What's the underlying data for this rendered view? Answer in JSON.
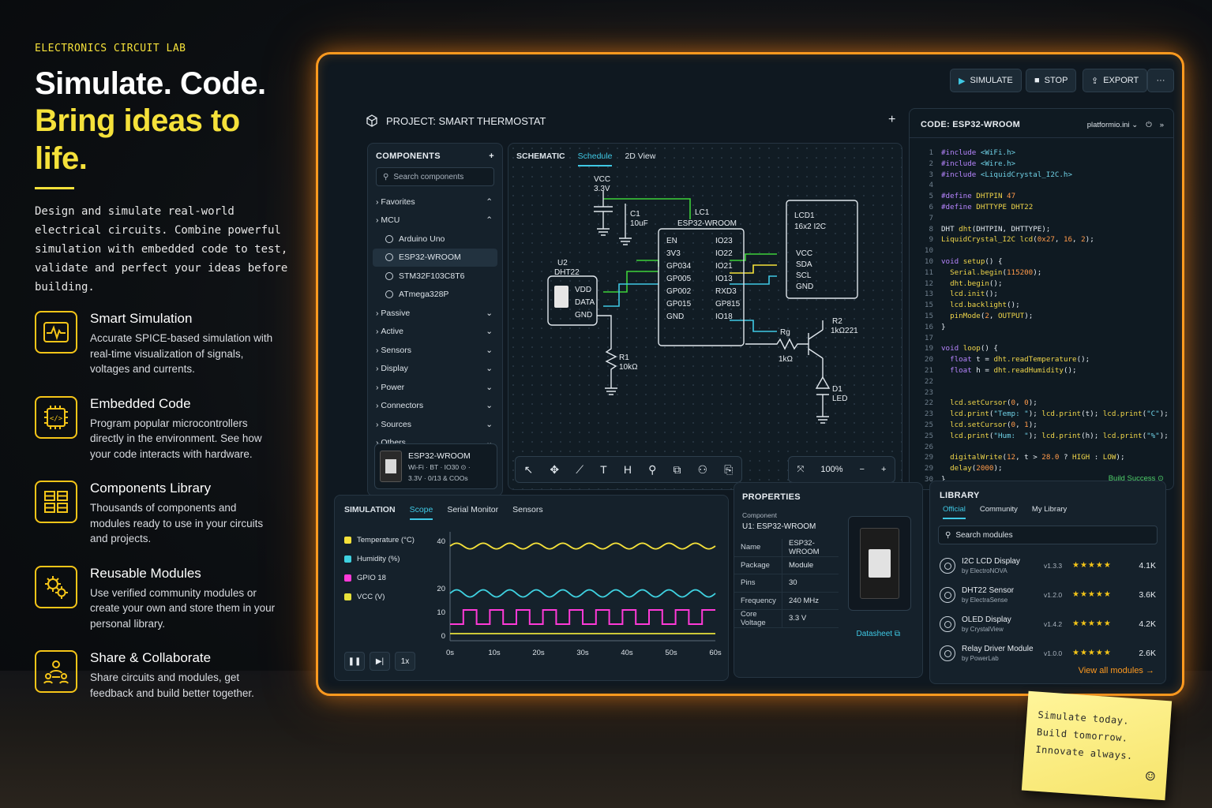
{
  "left": {
    "eyebrow": "ELECTRONICS CIRCUIT LAB",
    "headline_1": "Simulate. Code.",
    "headline_2": "Bring ideas to life.",
    "intro": "Design and simulate real-world electrical circuits. Combine powerful simulation with embedded code to test, validate and perfect your ideas before building.",
    "features": [
      {
        "icon": "waveform-icon",
        "title": "Smart Simulation",
        "desc": "Accurate SPICE-based simulation with real-time visualization of signals, voltages and currents."
      },
      {
        "icon": "chip-code-icon",
        "title": "Embedded Code",
        "desc": "Program popular microcontrollers directly in the environment. See how your code interacts with hardware."
      },
      {
        "icon": "library-icon",
        "title": "Components Library",
        "desc": "Thousands of components and modules ready to use in your circuits and projects."
      },
      {
        "icon": "gears-icon",
        "title": "Reusable Modules",
        "desc": "Use verified community modules or create your own and store them in your personal library."
      },
      {
        "icon": "users-icon",
        "title": "Share & Collaborate",
        "desc": "Share circuits and modules, get feedback and build better together."
      }
    ]
  },
  "toolbar": {
    "simulate": "SIMULATE",
    "stop": "STOP",
    "export": "EXPORT",
    "more": "···"
  },
  "project": {
    "title": "PROJECT: SMART THERMOSTAT",
    "add": "+"
  },
  "components": {
    "title": "COMPONENTS",
    "search_placeholder": "Search components",
    "favorites": "Favorites",
    "mcu": "MCU",
    "mcu_items": [
      "Arduino Uno",
      "ESP32-WROOM",
      "STM32F103C8T6",
      "ATmega328P"
    ],
    "categories": [
      "Passive",
      "Active",
      "Sensors",
      "Display",
      "Power",
      "Connectors",
      "Sources",
      "Others"
    ],
    "card_title": "ESP32-WROOM",
    "card_line1": "Wi-Fi · BT · IO30 ⊙ ·",
    "card_line2": "3.3V · 0/13 & COOs"
  },
  "schematic": {
    "tabs": [
      "SCHEMATIC",
      "Schedule",
      "2D View"
    ],
    "vcc": "VCC",
    "vcc_val": "3.3V",
    "c1": "C1",
    "c1_val": "10uF",
    "u2": "U2",
    "u2_part": "DHT22",
    "u2_pins": [
      "VDD",
      "DATA",
      "GND"
    ],
    "lc1": "LC1",
    "lc1_part": "ESP32-WROOM",
    "lc1_left": [
      "EN",
      "3V3",
      "GP034",
      "GP005",
      "GP002",
      "GP015",
      "GND"
    ],
    "lc1_right": [
      "IO23",
      "IO22",
      "IO21",
      "IO13",
      "RXD3",
      "GP815",
      "IO18"
    ],
    "lcd": "LCD1",
    "lcd_part": "16x2 I2C",
    "lcd_pins": [
      "VCC",
      "SDA",
      "SCL",
      "GND"
    ],
    "r1": "R1",
    "r1_val": "10kΩ",
    "rb": "Rg",
    "rb_val": "1kΩ",
    "r2": "R2",
    "r2_val": "1kΩ221",
    "d1": "D1",
    "d1_val": "LED",
    "tools": [
      "↖",
      "✥",
      "⟋",
      "T",
      "H",
      "⚲",
      "⧉",
      "⚇",
      "⎘"
    ],
    "zoom": "100%",
    "zoom_minus": "−",
    "zoom_plus": "+",
    "fit": "⤧"
  },
  "code": {
    "title": "CODE: ESP32-WROOM",
    "file": "platformio.ini",
    "status": "Build Success ⊙"
  },
  "simulation": {
    "title": "SIMULATION",
    "tabs": [
      "Scope",
      "Serial Monitor",
      "Sensors"
    ],
    "legend": [
      "Temperature (°C)",
      "Humidity (%)",
      "GPIO 18",
      "VCC (V)"
    ],
    "speed": "1x"
  },
  "chart_data": {
    "type": "line",
    "x": [
      0,
      10,
      20,
      30,
      40,
      50,
      60
    ],
    "x_tick_labels": [
      "0s",
      "10s",
      "20s",
      "30s",
      "40s",
      "50s",
      "60s"
    ],
    "y_ticks": [
      0,
      10,
      20,
      40
    ],
    "ylim": [
      -2,
      44
    ],
    "series": [
      {
        "name": "Temperature (°C)",
        "color": "#f5e13a",
        "kind": "wave",
        "base": 38,
        "amp": 1.2,
        "period": 6
      },
      {
        "name": "Humidity (%)",
        "color": "#3fd1e0",
        "kind": "wave",
        "base": 18,
        "amp": 1.5,
        "period": 6
      },
      {
        "name": "GPIO 18",
        "color": "#ff3ad8",
        "kind": "square",
        "low": 5,
        "high": 11,
        "period": 6
      },
      {
        "name": "VCC (V)",
        "color": "#e6e13a",
        "kind": "flat",
        "base": 1
      }
    ]
  },
  "properties": {
    "title": "PROPERTIES",
    "component_label": "Component",
    "component": "U1: ESP32-WROOM",
    "rows": [
      {
        "k": "Name",
        "v": "ESP32-WROOM"
      },
      {
        "k": "Package",
        "v": "Module"
      },
      {
        "k": "Pins",
        "v": "30"
      },
      {
        "k": "Frequency",
        "v": "240 MHz"
      },
      {
        "k": "Core Voltage",
        "v": "3.3 V"
      }
    ],
    "datasheet": "Datasheet ⧉"
  },
  "library": {
    "title": "LIBRARY",
    "tabs": [
      "Official",
      "Community",
      "My Library"
    ],
    "search_placeholder": "Search modules",
    "items": [
      {
        "name": "I2C LCD Display",
        "by": "by ElectroNOVA",
        "ver": "v1.3.3",
        "stars": "★★★★★",
        "count": "4.1K"
      },
      {
        "name": "DHT22 Sensor",
        "by": "by ElectraSense",
        "ver": "v1.2.0",
        "stars": "★★★★★",
        "count": "3.6K"
      },
      {
        "name": "OLED Display",
        "by": "by CrystalView",
        "ver": "v1.4.2",
        "stars": "★★★★★",
        "count": "4.2K"
      },
      {
        "name": "Relay Driver Module",
        "by": "by PowerLab",
        "ver": "v1.0.0",
        "stars": "★★★★★",
        "count": "2.6K"
      }
    ],
    "view_all": "View all modules →"
  },
  "sticky": {
    "line1": "Simulate today.",
    "line2": "Build tomorrow.",
    "line3": "Innovate always.",
    "smiley": "☺"
  },
  "colors": {
    "accent": "#f5e13a",
    "glow": "#ff9a1f",
    "cyan": "#3fc8e4",
    "wire_green": "#3ed13a",
    "wire_yellow": "#f5e13a"
  }
}
